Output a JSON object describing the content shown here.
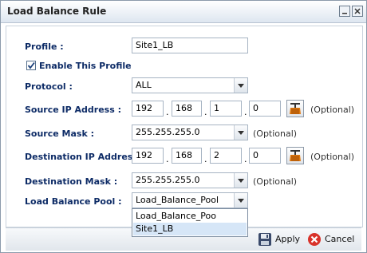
{
  "window": {
    "title": "Load Balance Rule"
  },
  "form": {
    "profile": {
      "label": "Profile :",
      "value": "Site1_LB"
    },
    "enable": {
      "label": "Enable This Profile",
      "checked": true
    },
    "protocol": {
      "label": "Protocol :",
      "value": "ALL"
    },
    "source_ip": {
      "label": "Source IP Address :",
      "octets": [
        "192",
        "168",
        "1",
        "0"
      ],
      "optional": "(Optional)"
    },
    "source_mask": {
      "label": "Source Mask :",
      "value": "255.255.255.0",
      "optional": "(Optional)"
    },
    "dest_ip": {
      "label": "Destination IP Address :",
      "octets": [
        "192",
        "168",
        "2",
        "0"
      ],
      "optional": "(Optional)"
    },
    "dest_mask": {
      "label": "Destination Mask :",
      "value": "255.255.255.0",
      "optional": "(Optional)"
    },
    "pool": {
      "label": "Load Balance Pool :",
      "value": "Load_Balance_Pool",
      "options": [
        "Load_Balance_Poo",
        "Site1_LB"
      ],
      "highlighted": "Site1_LB"
    }
  },
  "footer": {
    "apply_label": "Apply",
    "cancel_label": "Cancel"
  },
  "colors": {
    "label_text": "#0d2b66",
    "highlight": "#d6e6f7"
  }
}
